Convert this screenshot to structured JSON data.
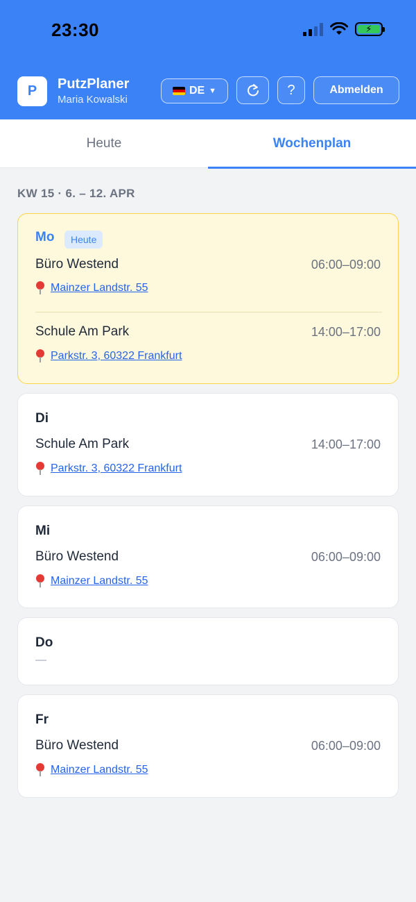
{
  "status_bar": {
    "time": "23:30"
  },
  "header": {
    "app_initial": "P",
    "app_name": "PutzPlaner",
    "user_name": "Maria Kowalski",
    "language": "DE",
    "help_label": "?",
    "logout_label": "Abmelden",
    "accent_color": "#3b82f6"
  },
  "tabs": [
    {
      "label": "Heute",
      "active": false
    },
    {
      "label": "Wochenplan",
      "active": true
    }
  ],
  "week_label": "KW 15 · 6. – 12. APR",
  "days": [
    {
      "name": "Mo",
      "badge": "Heute",
      "entries": [
        {
          "site": "Büro Westend",
          "time": "06:00–09:00",
          "address": "Mainzer Landstr. 55"
        },
        {
          "site": "Schule Am Park",
          "time": "14:00–17:00",
          "address": "Parkstr. 3, 60322 Frankfurt"
        }
      ]
    },
    {
      "name": "Di",
      "entries": [
        {
          "site": "Schule Am Park",
          "time": "14:00–17:00",
          "address": "Parkstr. 3, 60322 Frankfurt"
        }
      ]
    },
    {
      "name": "Mi",
      "entries": [
        {
          "site": "Büro Westend",
          "time": "06:00–09:00",
          "address": "Mainzer Landstr. 55"
        }
      ]
    },
    {
      "name": "Do",
      "empty_label": "—",
      "entries": []
    },
    {
      "name": "Fr",
      "entries": [
        {
          "site": "Büro Westend",
          "time": "06:00–09:00",
          "address": "Mainzer Landstr. 55"
        }
      ]
    }
  ]
}
